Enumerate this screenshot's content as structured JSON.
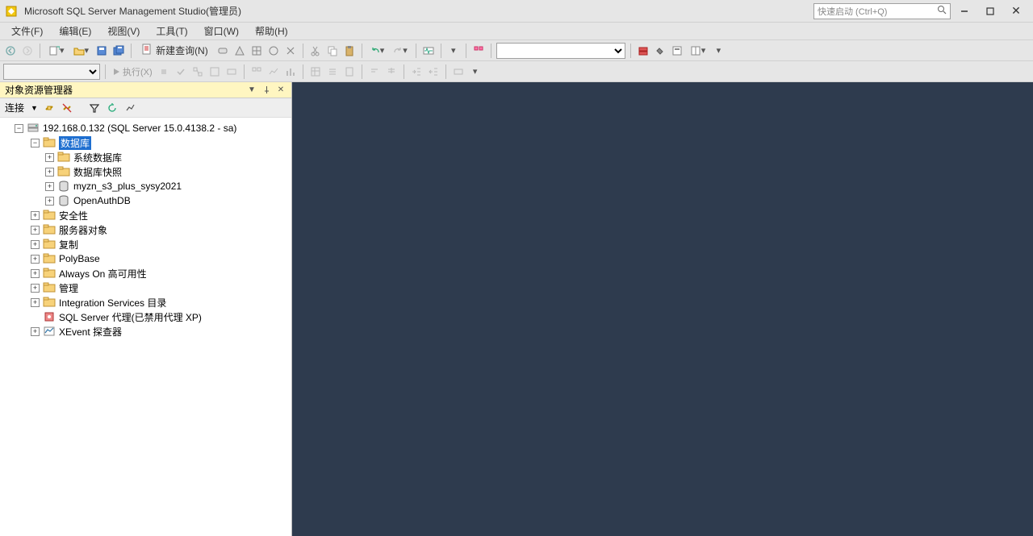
{
  "titlebar": {
    "title": "Microsoft SQL Server Management Studio(管理员)",
    "quicklaunch_placeholder": "快速启动 (Ctrl+Q)"
  },
  "menu": {
    "file": "文件(F)",
    "edit": "编辑(E)",
    "view": "视图(V)",
    "tools": "工具(T)",
    "window": "窗口(W)",
    "help": "帮助(H)"
  },
  "toolbar": {
    "new_query": "新建查询(N)",
    "execute": "执行(X)"
  },
  "object_explorer": {
    "title": "对象资源管理器",
    "connect_label": "连接",
    "server": "192.168.0.132 (SQL Server 15.0.4138.2 - sa)",
    "databases": "数据库",
    "system_databases": "系统数据库",
    "database_snapshots": "数据库快照",
    "db1": "myzn_s3_plus_sysy2021",
    "db2": "OpenAuthDB",
    "security": "安全性",
    "server_objects": "服务器对象",
    "replication": "复制",
    "polybase": "PolyBase",
    "alwayson": "Always On 高可用性",
    "management": "管理",
    "integration": "Integration Services 目录",
    "agent": "SQL Server 代理(已禁用代理 XP)",
    "xevent": "XEvent 探查器"
  }
}
